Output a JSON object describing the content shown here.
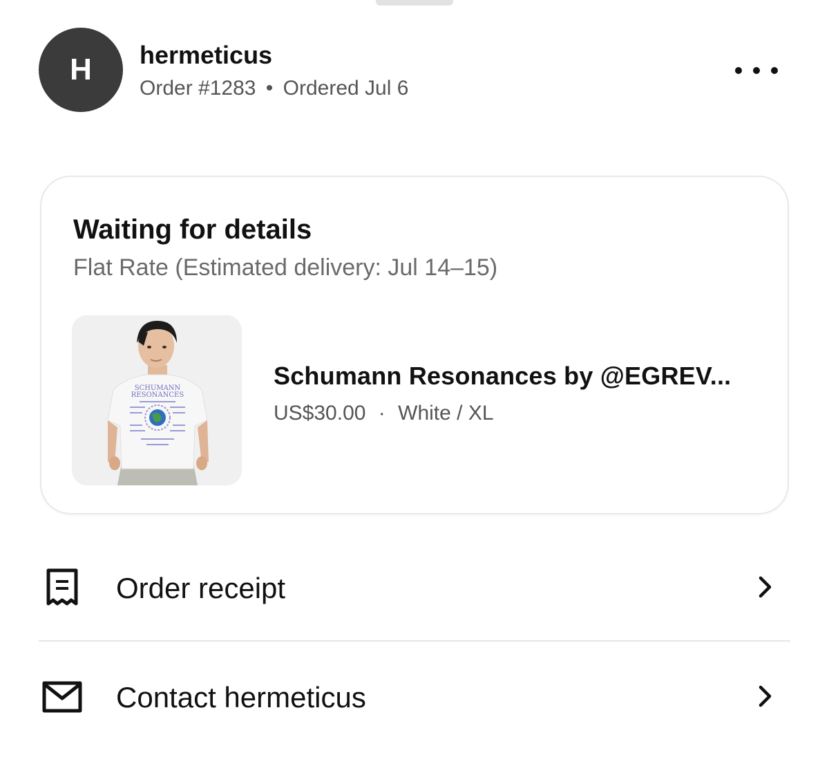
{
  "header": {
    "avatar_initial": "H",
    "shop_name": "hermeticus",
    "order_number": "Order #1283",
    "separator": "•",
    "ordered_date": "Ordered Jul 6",
    "more_icon": "more-horizontal-icon"
  },
  "status": {
    "title": "Waiting for details",
    "subtitle": "Flat Rate (Estimated delivery: Jul 14–15)"
  },
  "product": {
    "title": "Schumann Resonances by @EGREV...",
    "price": "US$30.00",
    "separator": "·",
    "variant": "White / XL",
    "shirt_print_line1": "SCHUMANN",
    "shirt_print_line2": "RESONANCES"
  },
  "actions": [
    {
      "label": "Order receipt",
      "icon": "receipt-icon"
    },
    {
      "label": "Contact hermeticus",
      "icon": "envelope-icon"
    }
  ],
  "colors": {
    "avatar_bg": "#3b3b3b",
    "text_primary": "#111111",
    "text_secondary": "#555555",
    "card_border": "#e8e8ee"
  }
}
